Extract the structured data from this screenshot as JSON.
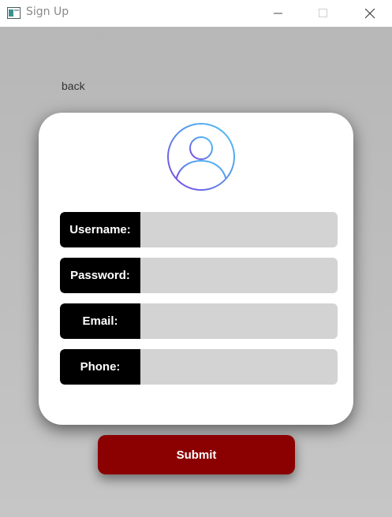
{
  "window": {
    "title": "Sign Up"
  },
  "nav": {
    "back_label": "back"
  },
  "form": {
    "fields": [
      {
        "label": "Username:",
        "value": ""
      },
      {
        "label": "Password:",
        "value": ""
      },
      {
        "label": "Email:",
        "value": ""
      },
      {
        "label": "Phone:",
        "value": ""
      }
    ],
    "submit_label": "Submit"
  },
  "icons": {
    "app": "window-app-icon",
    "minimize": "minimize-icon",
    "maximize": "maximize-icon",
    "close": "close-icon",
    "avatar": "user-avatar-icon"
  },
  "colors": {
    "submit": "#8b0000",
    "label_bg": "#000000",
    "input_bg": "#d3d3d3",
    "avatar_gradient_start": "#4fc3f7",
    "avatar_gradient_end": "#7b3fe4"
  }
}
